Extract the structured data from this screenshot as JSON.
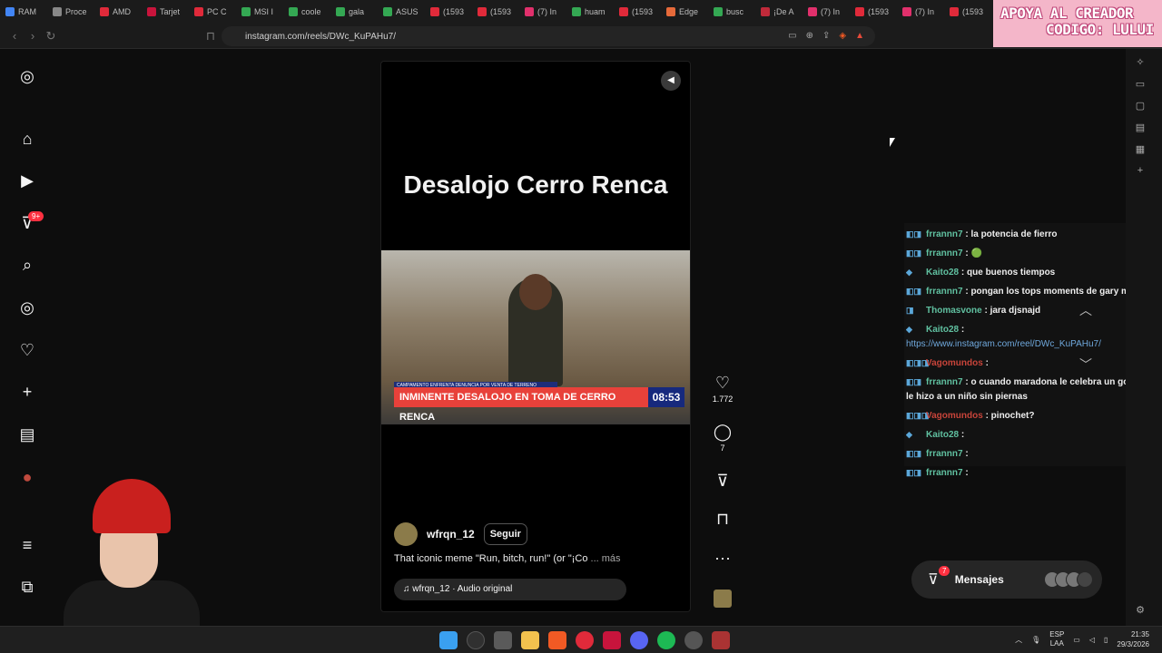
{
  "browser": {
    "tabs": [
      "RAM",
      "Proce",
      "AMD",
      "Tarjet",
      "PC C",
      "MSI I",
      "coole",
      "gala",
      "ASUS",
      "(1593",
      "(1593",
      "(7) In",
      "huam",
      "(1593",
      "Edge",
      "busc",
      "¡De A",
      "(7) In",
      "(1593",
      "(7) In",
      "(1593"
    ],
    "url": "instagram.com/reels/DWc_KuPAHu7/",
    "promo": {
      "line1": "APOYA AL CREADOR",
      "line2": "CODIGO: LULUI"
    }
  },
  "sidebar": {
    "notifications_badge": "9+"
  },
  "reel": {
    "title": "Desalojo Cerro Renca",
    "news_headline": "INMINENTE DESALOJO EN TOMA DE CERRO RENCA",
    "news_sub": "CAMPAMENTO ENFRENTA DENUNCIA POR VENTA DE TERRENO",
    "news_time": "08:53",
    "author": "wfrqn_12",
    "follow_label": "Seguir",
    "caption": "That iconic meme \"Run, bitch, run!\" (or \"¡Co",
    "caption_more": "... más",
    "audio": "wfrqn_12 · Audio original"
  },
  "actions": {
    "likes": "1.772",
    "comments": "7"
  },
  "chat": [
    {
      "user": "frrannn7",
      "text": ": la potencia de fierro",
      "badges": "◧◨"
    },
    {
      "user": "frrannn7",
      "text": ": 🟢",
      "badges": "◧◨"
    },
    {
      "user": "Kaito28",
      "text": ": que buenos tiempos",
      "badges": "◆"
    },
    {
      "user": "frrannn7",
      "text": ": pongan los tops moments de gary medel",
      "badges": "◧◨"
    },
    {
      "user": "Thomasvone",
      "text": ": jara djsnajd",
      "badges": "◨"
    },
    {
      "user": "Kaito28",
      "text": ":",
      "badges": "◆",
      "link": "https://www.instagram.com/reel/DWc_KuPAHu7/"
    },
    {
      "user": "Vagomundos",
      "text": ":",
      "badges": "◧◨◨",
      "red": true
    },
    {
      "user": "frrannn7",
      "text": ": o cuando maradona le celebra un gol que le hizo a un niño sin piernas",
      "badges": "◧◨"
    },
    {
      "user": "Vagomundos",
      "text": ": pinochet?",
      "badges": "◧◨◨",
      "red": true
    },
    {
      "user": "Kaito28",
      "text": ":",
      "badges": "◆"
    },
    {
      "user": "frrannn7",
      "text": ":",
      "badges": "◧◨"
    },
    {
      "user": "frrannn7",
      "text": ":",
      "badges": "◧◨"
    }
  ],
  "messages": {
    "label": "Mensajes",
    "badge": "7"
  },
  "tray": {
    "lang": "ESP",
    "lang2": "LAA",
    "time": "21:35",
    "date": "29/3/2026"
  }
}
